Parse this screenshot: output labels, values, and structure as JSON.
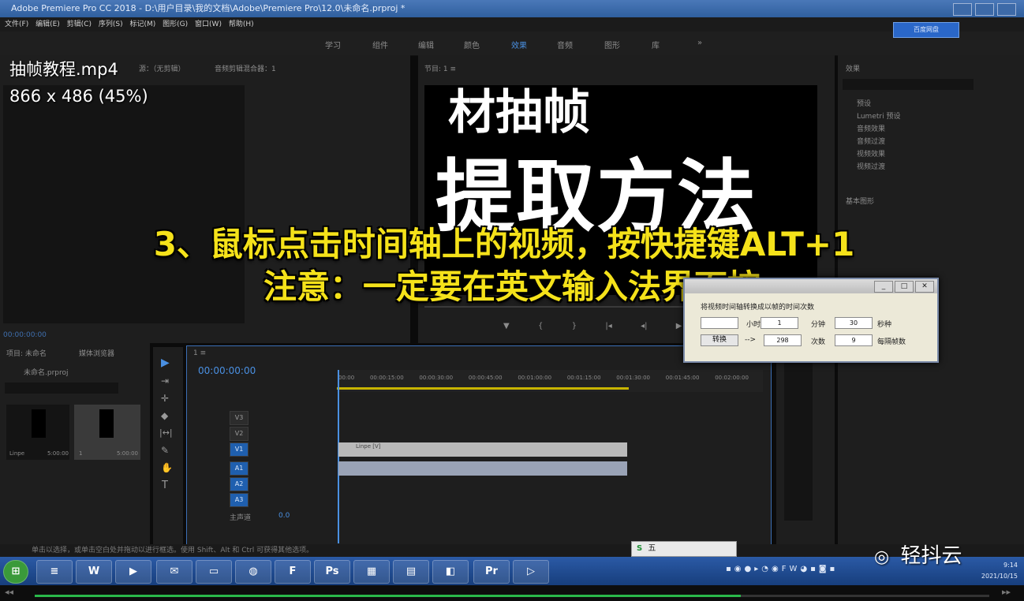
{
  "window": {
    "title": "Adobe Premiere Pro CC 2018 - D:\\用户目录\\我的文档\\Adobe\\Premiere Pro\\12.0\\未命名.prproj *",
    "menu": [
      "文件(F)",
      "编辑(E)",
      "剪辑(C)",
      "序列(S)",
      "标记(M)",
      "图形(G)",
      "窗口(W)",
      "帮助(H)"
    ]
  },
  "workspaces": [
    "学习",
    "组件",
    "编辑",
    "颜色",
    "效果",
    "音频",
    "图形",
    "库"
  ],
  "workspace_active": "效果",
  "overlay": {
    "filename": "抽帧教程.mp4",
    "resolution": "866 x 486 (45%)"
  },
  "source_panel": {
    "tab1": "源：（无剪辑）",
    "tab2": "音频剪辑混合器：1",
    "timecode": "00:00:00:00"
  },
  "program_panel": {
    "title": "节目: 1 ≡",
    "frame_text_top": "材抽帧",
    "frame_text_big": "提取方法"
  },
  "caption": {
    "line1": "3、鼠标点击时间轴上的视频，按快捷键ALT+1",
    "line2": "注意：一定要在英文输入法界面按"
  },
  "effects_panel": {
    "title": "效果",
    "items": [
      "预设",
      "Lumetri 预设",
      "音频效果",
      "音频过渡",
      "视频效果",
      "视频过渡"
    ],
    "section2": "基本图形"
  },
  "project_panel": {
    "tabs": [
      "项目: 未命名",
      "媒体浏览器"
    ],
    "project_file": "未命名.prproj",
    "clip1_name": "Linpe",
    "clip1_dur": "5:00:00",
    "clip2_name": "1",
    "clip2_dur": "5:00:00"
  },
  "timeline": {
    "title": "1 ≡",
    "timecode": "00:00:00:00",
    "ruler": [
      "00:00",
      "00:00:15:00",
      "00:00:30:00",
      "00:00:45:00",
      "00:01:00:00",
      "00:01:15:00",
      "00:01:30:00",
      "00:01:45:00",
      "00:02:00:00"
    ],
    "video_tracks": [
      "V3",
      "V2",
      "V1"
    ],
    "audio_tracks": [
      "A1",
      "A2",
      "A3"
    ],
    "master_label": "主声道",
    "master_value": "0.0",
    "clip_label": "Linpe [V]"
  },
  "dialog": {
    "title": "将视频时间轴转换成以帧的时间次数",
    "hour_label": "小时",
    "hour_value": "1",
    "minute_label": "分钟",
    "minute_value": "30",
    "second_label": "秒种",
    "convert_button": "转换",
    "arrow": "-->",
    "result_value": "298",
    "times_label": "次数",
    "times_value": "9",
    "per_label": "每隔帧数"
  },
  "status_bar": "单击以选择，或单击空白处并拖动以进行框选。使用 Shift、Alt 和 Ctrl 可获得其他选项。",
  "ime": "五",
  "taskbar": {
    "time": "9:14",
    "date": "2021/10/15"
  },
  "watermark": "轻抖云",
  "cloud_button": "百度网盘",
  "playback_progress": 0.74,
  "colors": {
    "caption": "#f5e21a",
    "accent": "#4a90e2",
    "taskbar": "#2b5aa6",
    "progress": "#2ab84a"
  }
}
